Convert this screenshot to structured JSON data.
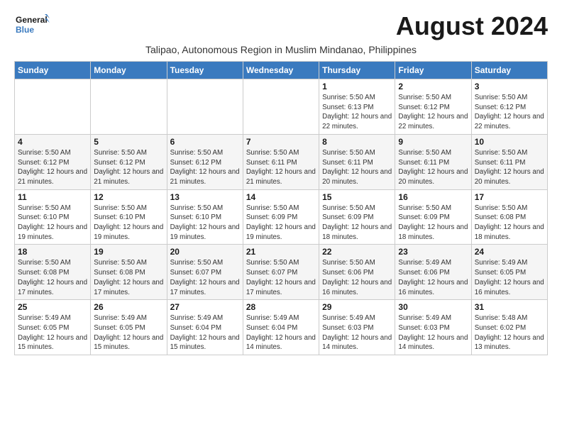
{
  "header": {
    "logo_line1": "General",
    "logo_line2": "Blue",
    "month_title": "August 2024",
    "subtitle": "Talipao, Autonomous Region in Muslim Mindanao, Philippines"
  },
  "days_of_week": [
    "Sunday",
    "Monday",
    "Tuesday",
    "Wednesday",
    "Thursday",
    "Friday",
    "Saturday"
  ],
  "weeks": [
    [
      {
        "day": "",
        "info": ""
      },
      {
        "day": "",
        "info": ""
      },
      {
        "day": "",
        "info": ""
      },
      {
        "day": "",
        "info": ""
      },
      {
        "day": "1",
        "info": "Sunrise: 5:50 AM\nSunset: 6:13 PM\nDaylight: 12 hours\nand 22 minutes."
      },
      {
        "day": "2",
        "info": "Sunrise: 5:50 AM\nSunset: 6:12 PM\nDaylight: 12 hours\nand 22 minutes."
      },
      {
        "day": "3",
        "info": "Sunrise: 5:50 AM\nSunset: 6:12 PM\nDaylight: 12 hours\nand 22 minutes."
      }
    ],
    [
      {
        "day": "4",
        "info": "Sunrise: 5:50 AM\nSunset: 6:12 PM\nDaylight: 12 hours\nand 21 minutes."
      },
      {
        "day": "5",
        "info": "Sunrise: 5:50 AM\nSunset: 6:12 PM\nDaylight: 12 hours\nand 21 minutes."
      },
      {
        "day": "6",
        "info": "Sunrise: 5:50 AM\nSunset: 6:12 PM\nDaylight: 12 hours\nand 21 minutes."
      },
      {
        "day": "7",
        "info": "Sunrise: 5:50 AM\nSunset: 6:11 PM\nDaylight: 12 hours\nand 21 minutes."
      },
      {
        "day": "8",
        "info": "Sunrise: 5:50 AM\nSunset: 6:11 PM\nDaylight: 12 hours\nand 20 minutes."
      },
      {
        "day": "9",
        "info": "Sunrise: 5:50 AM\nSunset: 6:11 PM\nDaylight: 12 hours\nand 20 minutes."
      },
      {
        "day": "10",
        "info": "Sunrise: 5:50 AM\nSunset: 6:11 PM\nDaylight: 12 hours\nand 20 minutes."
      }
    ],
    [
      {
        "day": "11",
        "info": "Sunrise: 5:50 AM\nSunset: 6:10 PM\nDaylight: 12 hours\nand 19 minutes."
      },
      {
        "day": "12",
        "info": "Sunrise: 5:50 AM\nSunset: 6:10 PM\nDaylight: 12 hours\nand 19 minutes."
      },
      {
        "day": "13",
        "info": "Sunrise: 5:50 AM\nSunset: 6:10 PM\nDaylight: 12 hours\nand 19 minutes."
      },
      {
        "day": "14",
        "info": "Sunrise: 5:50 AM\nSunset: 6:09 PM\nDaylight: 12 hours\nand 19 minutes."
      },
      {
        "day": "15",
        "info": "Sunrise: 5:50 AM\nSunset: 6:09 PM\nDaylight: 12 hours\nand 18 minutes."
      },
      {
        "day": "16",
        "info": "Sunrise: 5:50 AM\nSunset: 6:09 PM\nDaylight: 12 hours\nand 18 minutes."
      },
      {
        "day": "17",
        "info": "Sunrise: 5:50 AM\nSunset: 6:08 PM\nDaylight: 12 hours\nand 18 minutes."
      }
    ],
    [
      {
        "day": "18",
        "info": "Sunrise: 5:50 AM\nSunset: 6:08 PM\nDaylight: 12 hours\nand 17 minutes."
      },
      {
        "day": "19",
        "info": "Sunrise: 5:50 AM\nSunset: 6:08 PM\nDaylight: 12 hours\nand 17 minutes."
      },
      {
        "day": "20",
        "info": "Sunrise: 5:50 AM\nSunset: 6:07 PM\nDaylight: 12 hours\nand 17 minutes."
      },
      {
        "day": "21",
        "info": "Sunrise: 5:50 AM\nSunset: 6:07 PM\nDaylight: 12 hours\nand 17 minutes."
      },
      {
        "day": "22",
        "info": "Sunrise: 5:50 AM\nSunset: 6:06 PM\nDaylight: 12 hours\nand 16 minutes."
      },
      {
        "day": "23",
        "info": "Sunrise: 5:49 AM\nSunset: 6:06 PM\nDaylight: 12 hours\nand 16 minutes."
      },
      {
        "day": "24",
        "info": "Sunrise: 5:49 AM\nSunset: 6:05 PM\nDaylight: 12 hours\nand 16 minutes."
      }
    ],
    [
      {
        "day": "25",
        "info": "Sunrise: 5:49 AM\nSunset: 6:05 PM\nDaylight: 12 hours\nand 15 minutes."
      },
      {
        "day": "26",
        "info": "Sunrise: 5:49 AM\nSunset: 6:05 PM\nDaylight: 12 hours\nand 15 minutes."
      },
      {
        "day": "27",
        "info": "Sunrise: 5:49 AM\nSunset: 6:04 PM\nDaylight: 12 hours\nand 15 minutes."
      },
      {
        "day": "28",
        "info": "Sunrise: 5:49 AM\nSunset: 6:04 PM\nDaylight: 12 hours\nand 14 minutes."
      },
      {
        "day": "29",
        "info": "Sunrise: 5:49 AM\nSunset: 6:03 PM\nDaylight: 12 hours\nand 14 minutes."
      },
      {
        "day": "30",
        "info": "Sunrise: 5:49 AM\nSunset: 6:03 PM\nDaylight: 12 hours\nand 14 minutes."
      },
      {
        "day": "31",
        "info": "Sunrise: 5:48 AM\nSunset: 6:02 PM\nDaylight: 12 hours\nand 13 minutes."
      }
    ]
  ]
}
